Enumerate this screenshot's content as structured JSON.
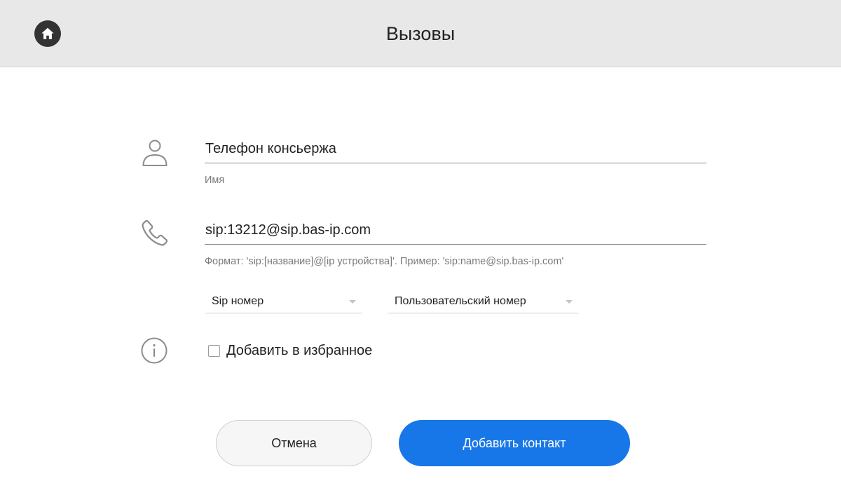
{
  "header": {
    "title": "Вызовы",
    "home_icon": "home-icon"
  },
  "form": {
    "name": {
      "icon": "person-icon",
      "value": "Телефон консьержа",
      "hint": "Имя"
    },
    "address": {
      "icon": "phone-icon",
      "value": "sip:13212@sip.bas-ip.com",
      "hint": "Формат: 'sip:[название]@[ip устройства]'. Пример: 'sip:name@sip.bas-ip.com'"
    },
    "type_select": {
      "selected": "Sip номер"
    },
    "category_select": {
      "selected": "Пользовательский номер"
    },
    "favorite": {
      "icon": "info-icon",
      "label": "Добавить в избранное",
      "checked": false
    }
  },
  "buttons": {
    "cancel_label": "Отмена",
    "submit_label": "Добавить контакт"
  },
  "colors": {
    "header_bg": "#e8e8e8",
    "primary": "#1877e8",
    "icon_gray": "#8c8c8c"
  }
}
